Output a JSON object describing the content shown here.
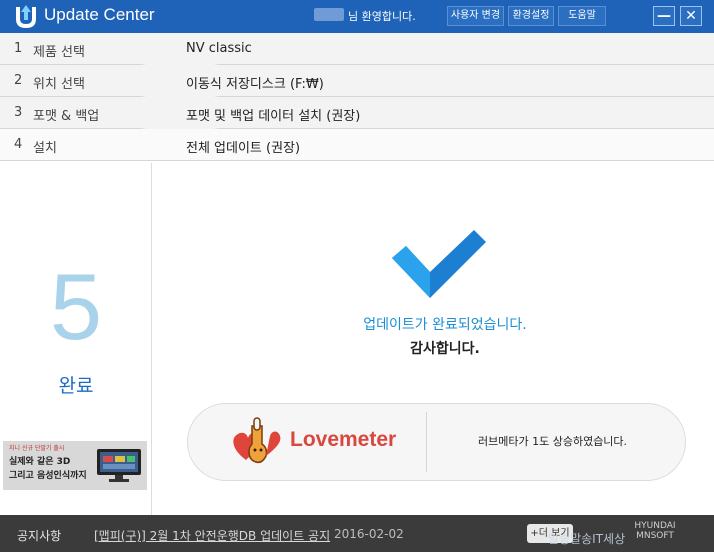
{
  "titlebar": {
    "app_title": "Update Center",
    "welcome": "님 환영합니다.",
    "buttons": [
      "사용자 변경",
      "환경설정",
      "도움말"
    ],
    "minimize_glyph": "—",
    "close_glyph": "✕"
  },
  "steps": [
    {
      "num": "1",
      "name": "제품 선택",
      "value": "NV classic"
    },
    {
      "num": "2",
      "name": "위치 선택",
      "value": "이동식 저장디스크 (F:₩)"
    },
    {
      "num": "3",
      "name": "포맷 & 백업",
      "value": "포맷 및 백업 데이터 설치 (권장)"
    },
    {
      "num": "4",
      "name": "설치",
      "value": "전체 업데이트 (권장)"
    }
  ],
  "left": {
    "step_number": "5",
    "step_label": "완료",
    "ad": {
      "small": "지니 신규 단말기 출시",
      "line1": "실제와 같은 3D",
      "line2": "그리고 음성인식까지"
    }
  },
  "main": {
    "done_message": "업데이트가 완료되었습니다.",
    "thanks": "감사합니다.",
    "lovemeter": {
      "logo": "Lovemeter",
      "status": "러브메타가 1도 상승하였습니다."
    }
  },
  "notice": {
    "label": "공지사항",
    "link": "[맵피(구)] 2월 1차 안전운행DB 업데이트 공지",
    "date": "2016-02-02",
    "more": "+더 보기",
    "brand_line1": "HYUNDAI",
    "brand_line2": "MNSOFT",
    "watermark": "말송말송IT세상"
  },
  "colors": {
    "titlebar": "#1e63b7",
    "accent": "#1b8fd4",
    "step_number": "#a9d3ea"
  },
  "icons": [
    "logo-icon",
    "checkmark-icon",
    "lovemeter-mascot-icon",
    "tv-icon"
  ]
}
